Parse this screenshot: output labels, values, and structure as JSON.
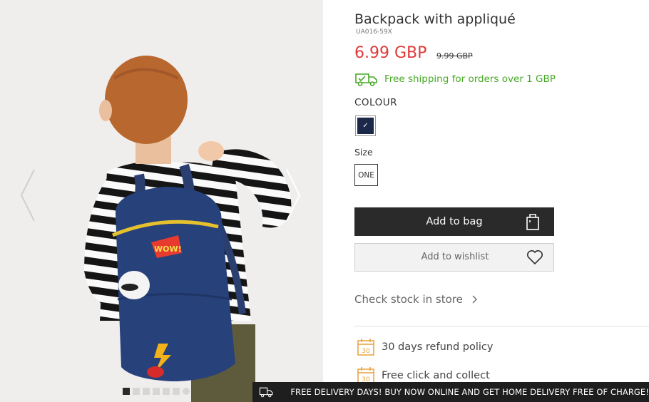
{
  "product": {
    "title": "Backpack with appliqué",
    "sku": "UA016-59X",
    "price": "6.99 GBP",
    "old_price": "9.99 GBP",
    "shipping": "Free shipping for orders over 1 GBP",
    "colour_label": "COLOUR",
    "colour_selected": "#1b2849",
    "size_label": "Size",
    "size_option": "ONE",
    "add_to_bag": "Add to bag",
    "add_to_wishlist": "Add to wishlist",
    "check_stock": "Check stock in store"
  },
  "perks": [
    {
      "icon": "calendar-30-icon",
      "label": "30 days refund policy",
      "badge": "30"
    },
    {
      "icon": "calendar-30-icon",
      "label": "Free click and collect",
      "badge": "30"
    }
  ],
  "gallery": {
    "dots": 7,
    "active_index": 0
  },
  "banner": {
    "text": "FREE DELIVERY DAYS! BUY NOW ONLINE AND GET HOME DELIVERY FREE OF CHARGE!"
  },
  "colors": {
    "price": "#e03a3a",
    "shipping": "#46a825",
    "perk_icon": "#e6a23c",
    "button_dark": "#2a2a2a"
  }
}
